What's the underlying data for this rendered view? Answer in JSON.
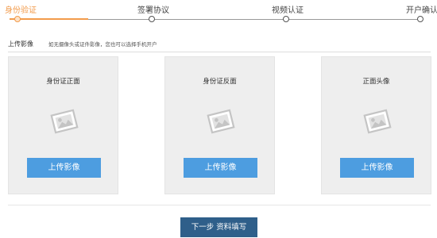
{
  "stepper": {
    "steps": [
      {
        "label": "身份验证",
        "active": true
      },
      {
        "label": "签署协议",
        "active": false
      },
      {
        "label": "视频认证",
        "active": false
      },
      {
        "label": "开户确认",
        "active": false
      }
    ],
    "active_color": "#f29b4b"
  },
  "upload": {
    "title": "上传影像",
    "hint": "如无摄像头或证件影像，您也可以选择手机开户",
    "cards": [
      {
        "title": "身份证正面",
        "icon": "image-placeholder-icon",
        "button_label": "上传影像"
      },
      {
        "title": "身份证反面",
        "icon": "image-placeholder-icon",
        "button_label": "上传影像"
      },
      {
        "title": "正面头像",
        "icon": "image-placeholder-icon",
        "button_label": "上传影像"
      }
    ],
    "button_color": "#4d9de0"
  },
  "footer": {
    "next_button_label": "下一步 资料填写",
    "next_button_color": "#2f5f8a"
  }
}
